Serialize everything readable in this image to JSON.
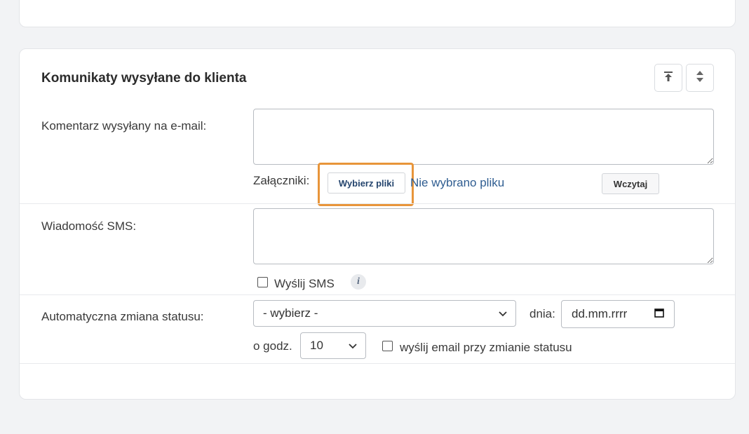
{
  "section": {
    "title": "Komunikaty wysyłane do klienta",
    "buttons": [
      {
        "icon": "move-to-top-icon"
      },
      {
        "icon": "sort-arrows-icon"
      }
    ]
  },
  "email": {
    "label": "Komentarz wysyłany na e-mail:",
    "value": "",
    "attachments_label": "Załączniki:",
    "choose_files_label": "Wybierz pliki",
    "no_file_text": "Nie wybrano pliku",
    "load_label": "Wczytaj"
  },
  "sms": {
    "label": "Wiadomość SMS:",
    "value": "",
    "send_checkbox_label": "Wyślij SMS",
    "send_checked": false,
    "info_icon_text": "i"
  },
  "status": {
    "label": "Automatyczna zmiana statusu:",
    "select_value": "- wybierz -",
    "day_label": "dnia:",
    "date_placeholder": "dd.mm.rrrr",
    "hour_label": "o godz.",
    "hour_value": "10",
    "email_on_change_label": "wyślij email przy zmianie statusu",
    "email_on_change_checked": false
  },
  "colors": {
    "accent_highlight": "#e8953a",
    "link_blue": "#2f5d91",
    "button_text_blue": "#25456e"
  }
}
